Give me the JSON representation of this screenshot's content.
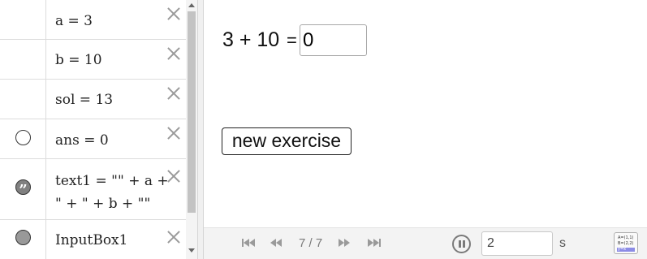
{
  "algebra": {
    "rows": [
      {
        "text": "a = 3",
        "marble": "none"
      },
      {
        "text": "b = 10",
        "marble": "none"
      },
      {
        "text": "sol = 13",
        "marble": "none"
      },
      {
        "text": "ans = 0",
        "marble": "empty"
      },
      {
        "line1": "text1 = \"\" + a +",
        "line2": "\" + \" + b + \"\"",
        "marble": "quote",
        "marble_glyph": "”"
      },
      {
        "text": "InputBox1",
        "marble": "filled"
      }
    ]
  },
  "graphics": {
    "equation": "3 + 10",
    "eq_sign": "=",
    "answer_value": "0",
    "new_exercise_label": "new exercise"
  },
  "playbar": {
    "counter": "7 / 7",
    "speed_value": "2",
    "unit": "s",
    "table_icon_lines": [
      "A=(1,1)",
      "B=(2,2)",
      "y=x"
    ]
  },
  "colors": {
    "marble_filled": "#999999",
    "close_icon": "#9a9a9a",
    "table_icon_highlight": "#8c8ce6"
  }
}
